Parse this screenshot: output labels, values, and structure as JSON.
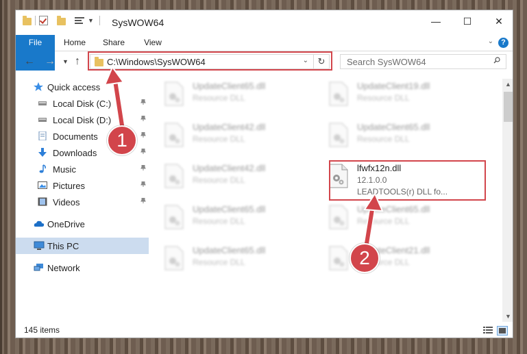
{
  "window": {
    "title": "SysWOW64",
    "minimize": "—",
    "maximize": "☐",
    "close": "✕"
  },
  "ribbon": {
    "tabs": [
      "File",
      "Home",
      "Share",
      "View"
    ],
    "help": "?"
  },
  "nav": {
    "address": "C:\\Windows\\SysWOW64",
    "search_placeholder": "Search SysWOW64"
  },
  "sidebar": {
    "items": [
      {
        "label": "Quick access",
        "icon": "star-icon"
      },
      {
        "label": "Local Disk (C:)",
        "icon": "drive-icon"
      },
      {
        "label": "Local Disk (D:)",
        "icon": "drive-icon"
      },
      {
        "label": "Documents",
        "icon": "documents-icon"
      },
      {
        "label": "Downloads",
        "icon": "download-icon"
      },
      {
        "label": "Music",
        "icon": "music-icon"
      },
      {
        "label": "Pictures",
        "icon": "pictures-icon"
      },
      {
        "label": "Videos",
        "icon": "videos-icon"
      },
      {
        "label": "OneDrive",
        "icon": "cloud-icon"
      },
      {
        "label": "This PC",
        "icon": "computer-icon"
      },
      {
        "label": "Network",
        "icon": "network-icon"
      }
    ]
  },
  "files": [
    {
      "name": "UpdateClient65.dll",
      "desc": "Resource DLL"
    },
    {
      "name": "UpdateClient19.dll",
      "desc": "Resource DLL"
    },
    {
      "name": "UpdateClient42.dll",
      "desc": "Resource DLL"
    },
    {
      "name": "UpdateClient65.dll",
      "desc": "Resource DLL"
    },
    {
      "name": "UpdateClient42.dll",
      "desc": "Resource DLL"
    },
    {
      "name": "UpdateClient65.dll",
      "desc": "Resource DLL"
    },
    {
      "name": "UpdateClient65.dll",
      "desc": "Resource DLL"
    },
    {
      "name": "UpdateClient65.dll",
      "desc": "Resource DLL"
    },
    {
      "name": "UpdateClient21.dll",
      "desc": "Resource DLL"
    }
  ],
  "highlighted_file": {
    "name": "lfwfx12n.dll",
    "version": "12.1.0.0",
    "desc": "LEADTOOLS(r) DLL fo..."
  },
  "status": {
    "count": "145 items"
  },
  "callouts": [
    "1",
    "2"
  ],
  "colors": {
    "accent": "#1979ca",
    "highlight": "#d2454b",
    "selected": "#ccdcef"
  }
}
